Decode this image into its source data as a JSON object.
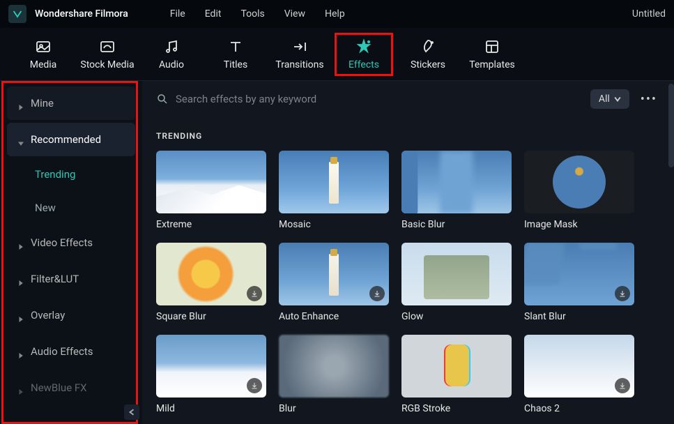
{
  "app": {
    "name": "Wondershare Filmora",
    "document": "Untitled"
  },
  "menu": [
    "File",
    "Edit",
    "Tools",
    "View",
    "Help"
  ],
  "toolbar": [
    {
      "id": "media",
      "label": "Media"
    },
    {
      "id": "stock-media",
      "label": "Stock Media"
    },
    {
      "id": "audio",
      "label": "Audio"
    },
    {
      "id": "titles",
      "label": "Titles"
    },
    {
      "id": "transitions",
      "label": "Transitions"
    },
    {
      "id": "effects",
      "label": "Effects",
      "active": true
    },
    {
      "id": "stickers",
      "label": "Stickers"
    },
    {
      "id": "templates",
      "label": "Templates"
    }
  ],
  "sidebar": {
    "items": [
      {
        "id": "mine",
        "label": "Mine",
        "expandable": true
      },
      {
        "id": "recommended",
        "label": "Recommended",
        "expandable": true,
        "expanded": true,
        "children": [
          {
            "id": "trending",
            "label": "Trending",
            "active": true
          },
          {
            "id": "new",
            "label": "New"
          }
        ]
      },
      {
        "id": "video-effects",
        "label": "Video Effects",
        "expandable": true
      },
      {
        "id": "filter-lut",
        "label": "Filter&LUT",
        "expandable": true
      },
      {
        "id": "overlay",
        "label": "Overlay",
        "expandable": true
      },
      {
        "id": "audio-effects",
        "label": "Audio Effects",
        "expandable": true
      },
      {
        "id": "newblue-fx",
        "label": "NewBlue FX",
        "expandable": true,
        "dimmed": true
      }
    ]
  },
  "search": {
    "placeholder": "Search effects by any keyword"
  },
  "filter": {
    "label": "All"
  },
  "section": {
    "title": "TRENDING"
  },
  "effects": [
    {
      "id": "extreme",
      "label": "Extreme",
      "thumb": "t-extreme"
    },
    {
      "id": "mosaic",
      "label": "Mosaic",
      "thumb": "t-lighthouse t-mosaic"
    },
    {
      "id": "basic-blur",
      "label": "Basic Blur",
      "thumb": "t-lighthouse t-basicblur"
    },
    {
      "id": "image-mask",
      "label": "Image Mask",
      "thumb": "t-imagemask"
    },
    {
      "id": "square-blur",
      "label": "Square Blur",
      "thumb": "t-flower",
      "downloadable": true
    },
    {
      "id": "auto-enhance",
      "label": "Auto Enhance",
      "thumb": "t-lighthouse",
      "downloadable": true
    },
    {
      "id": "glow",
      "label": "Glow",
      "thumb": "t-glow"
    },
    {
      "id": "slant-blur",
      "label": "Slant Blur",
      "thumb": "t-lighthouse t-slant",
      "downloadable": true
    },
    {
      "id": "mild",
      "label": "Mild",
      "thumb": "t-mild",
      "downloadable": true
    },
    {
      "id": "blur",
      "label": "Blur",
      "thumb": "t-blur"
    },
    {
      "id": "rgb-stroke",
      "label": "RGB Stroke",
      "thumb": "t-rgb"
    },
    {
      "id": "chaos-2",
      "label": "Chaos 2",
      "thumb": "t-chaos",
      "downloadable": true
    }
  ]
}
